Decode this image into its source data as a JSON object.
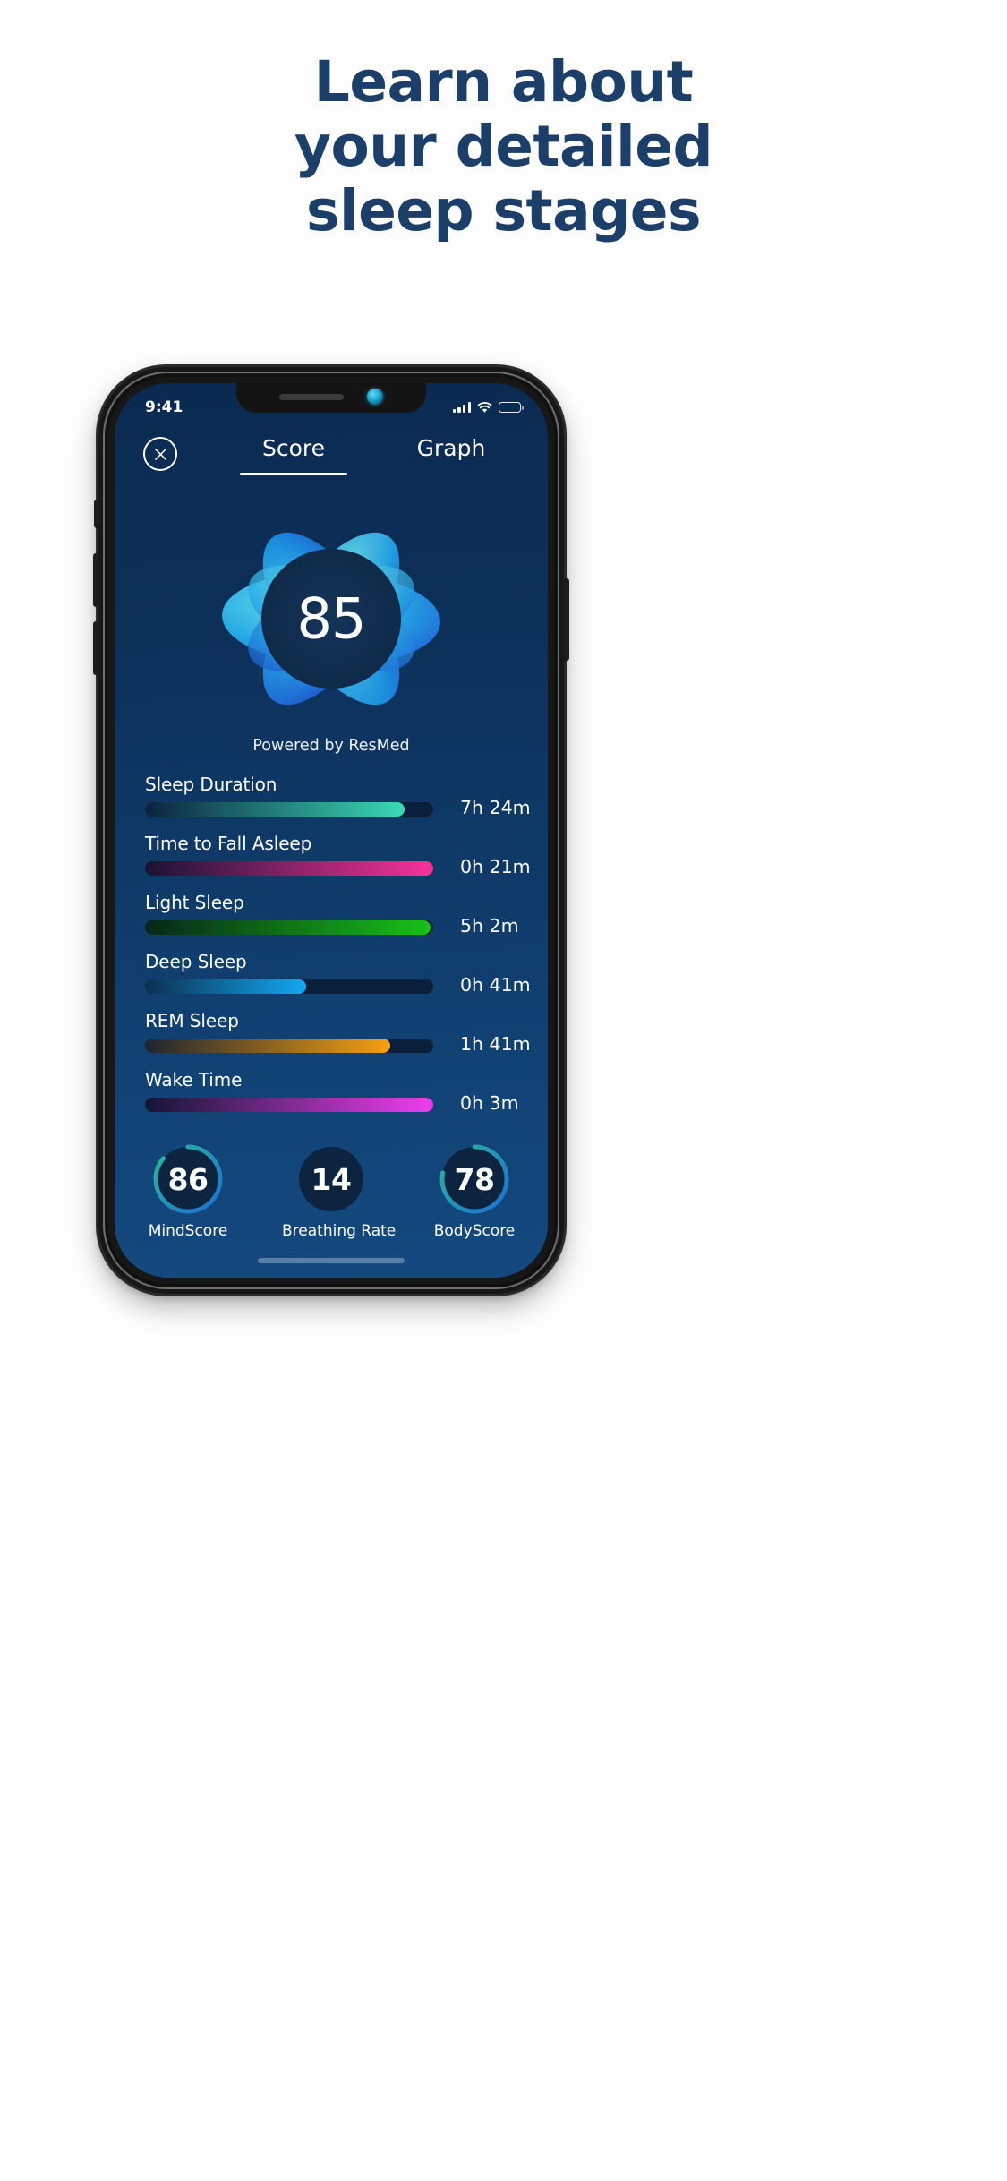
{
  "headline": {
    "line1": "Learn about",
    "line2": "your detailed",
    "line3": "sleep stages",
    "color": "#1b3f68"
  },
  "phone": {
    "status_bar": {
      "time": "9:41",
      "cellular_icon": "signal-bars-icon",
      "wifi_icon": "wifi-icon",
      "battery_icon": "battery-full-icon"
    },
    "notch": {
      "speaker_icon": "speaker-grille-icon",
      "camera_icon": "front-camera-icon"
    },
    "home_indicator": "home-indicator"
  },
  "app": {
    "close_icon": "close-circle-icon",
    "tabs": [
      {
        "label": "Score",
        "active": true
      },
      {
        "label": "Graph",
        "active": false
      }
    ],
    "score_orb": {
      "value": "85",
      "icon": "sleep-score-orb-icon"
    },
    "powered_by": "Powered by ResMed",
    "metrics": [
      {
        "label": "Sleep Duration",
        "value": "7h 24m",
        "percent": 90,
        "from": "#0c2340",
        "to": "#3ad9b4"
      },
      {
        "label": "Time to Fall Asleep",
        "value": "0h 21m",
        "percent": 100,
        "from": "#191333",
        "to": "#f5339b"
      },
      {
        "label": "Light Sleep",
        "value": "5h 2m",
        "percent": 99,
        "from": "#08261a",
        "to": "#17c116"
      },
      {
        "label": "Deep Sleep",
        "value": "0h 41m",
        "percent": 56,
        "from": "#0d3050",
        "to": "#12a9f0"
      },
      {
        "label": "REM Sleep",
        "value": "1h 41m",
        "percent": 85,
        "from": "#1e2530",
        "to": "#f79f11"
      },
      {
        "label": "Wake Time",
        "value": "0h 3m",
        "percent": 100,
        "from": "#121633",
        "to": "#ed3ff0"
      }
    ],
    "sub_scores": [
      {
        "value": "86",
        "label": "MindScore",
        "percent": 86,
        "has_ring": true
      },
      {
        "value": "14",
        "label": "Breathing  Rate",
        "percent": 0,
        "has_ring": false
      },
      {
        "value": "78",
        "label": "BodyScore",
        "percent": 78,
        "has_ring": true
      }
    ]
  },
  "colors": {
    "screen_top": "#0a2a51",
    "screen_bottom": "#14497f",
    "track": "#0a1f3c",
    "ring_start": "#2bb79b",
    "ring_end": "#1b6fd4"
  }
}
